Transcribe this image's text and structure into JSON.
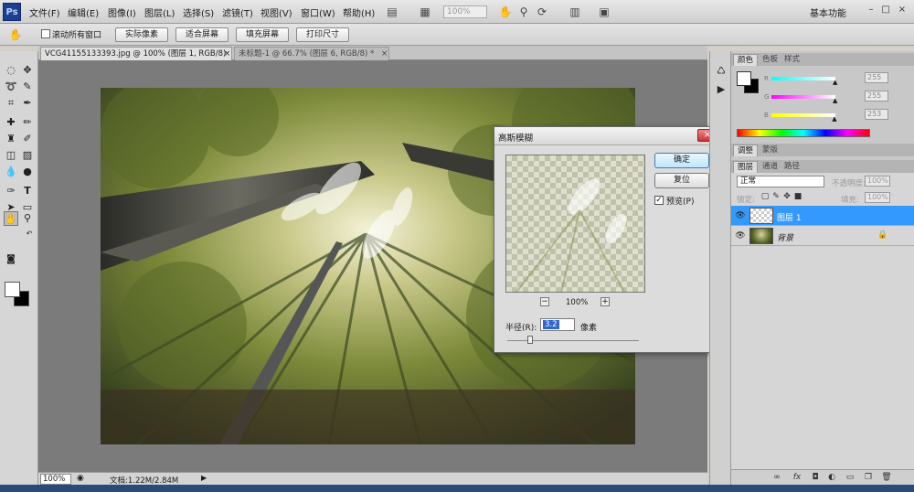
{
  "app": {
    "logo": "Ps",
    "workspace": "基本功能"
  },
  "menu": [
    "文件(F)",
    "编辑(E)",
    "图像(I)",
    "图层(L)",
    "选择(S)",
    "滤镜(T)",
    "视图(V)",
    "窗口(W)",
    "帮助(H)"
  ],
  "appbar": {
    "zoom": "100%"
  },
  "window_controls": {
    "min": "–",
    "max": "□",
    "close": "×"
  },
  "options": {
    "scroll_all_windows": "滚动所有窗口",
    "actual_pixels": "实际像素",
    "fit_screen": "适合屏幕",
    "fill_screen": "填充屏幕",
    "print_size": "打印尺寸"
  },
  "tabs": [
    {
      "label": "VCG41155133393.jpg @ 100% (图层 1, RGB/8) *",
      "close": "×",
      "active": true
    },
    {
      "label": "未标题-1 @ 66.7% (图层 6, RGB/8) *",
      "close": "×",
      "active": false
    }
  ],
  "status": {
    "zoom": "100%",
    "doc_info": "文档:1.22M/2.84M"
  },
  "dialog": {
    "title": "高斯模糊",
    "close": "×",
    "ok": "确定",
    "reset": "复位",
    "preview_label": "预览(P)",
    "preview_checked": true,
    "zoom_minus": "−",
    "zoom_plus": "+",
    "preview_zoom": "100%",
    "radius_label": "半径(R):",
    "radius_value": "3.2",
    "radius_unit": "像素"
  },
  "color_panel": {
    "tabs": [
      "颜色",
      "色板",
      "样式"
    ],
    "r_label": "R",
    "g_label": "G",
    "b_label": "B",
    "r": "255",
    "g": "255",
    "b": "253",
    "r_level": 1.0,
    "g_level": 1.0,
    "b_level": 0.99
  },
  "adjust_tabs": [
    "调整",
    "蒙版"
  ],
  "layers_panel": {
    "tabs": [
      "图层",
      "通道",
      "路径"
    ],
    "blend_mode": "正常",
    "opacity_label": "不透明度:",
    "opacity": "100%",
    "lock_label": "锁定:",
    "fill_label": "填充:",
    "fill": "100%",
    "layers": [
      {
        "name": "图层 1",
        "selected": true,
        "visible": true
      },
      {
        "name": "背景",
        "selected": false,
        "visible": true,
        "locked": true
      }
    ]
  },
  "colors": {
    "selection": "#3399ff",
    "dialog_close": "#cc3333"
  }
}
